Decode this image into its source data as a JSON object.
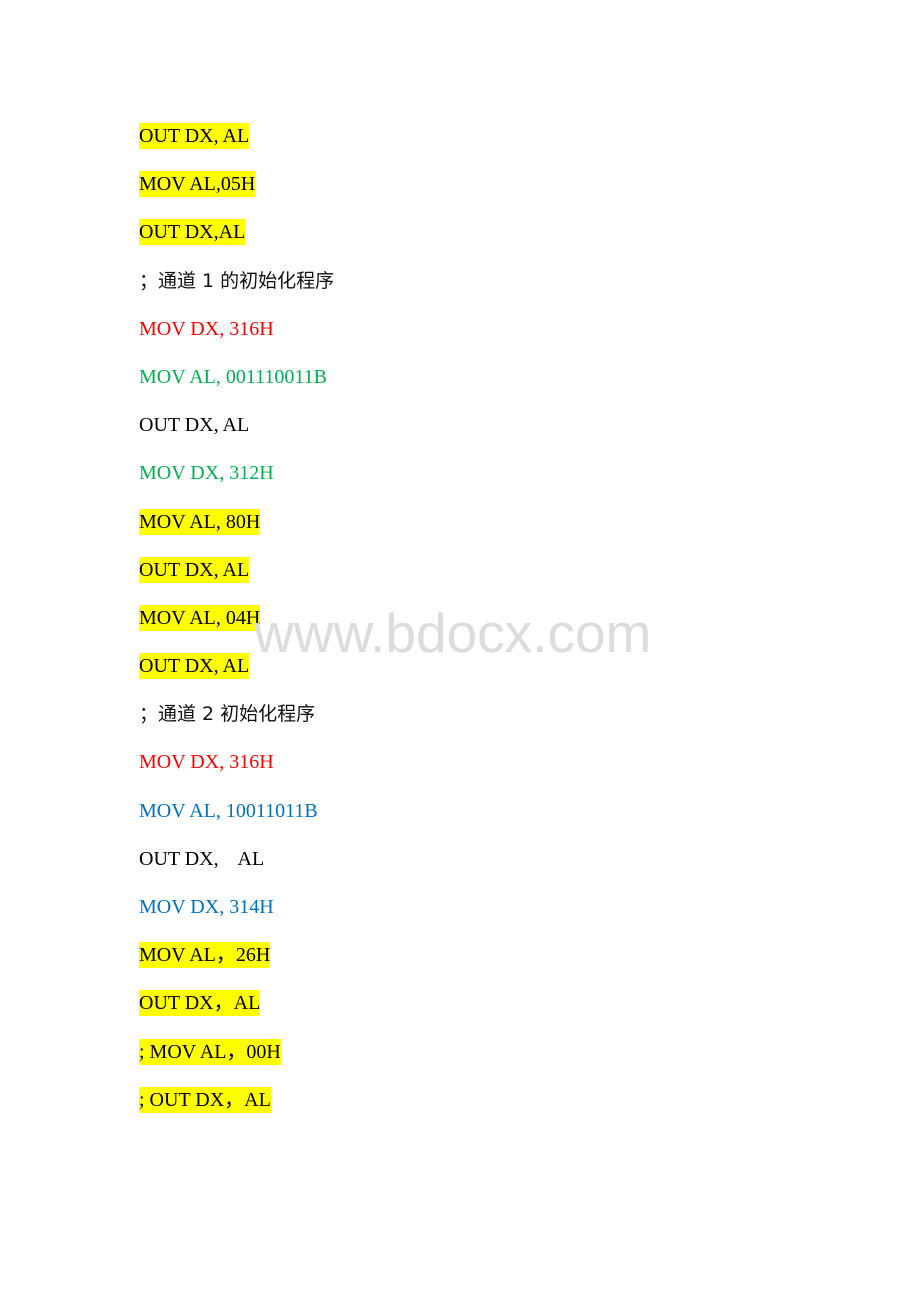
{
  "document": {
    "lines": [
      {
        "text": "OUT DX, AL",
        "color": "black",
        "highlight": true
      },
      {
        "text": "MOV AL,05H",
        "color": "black",
        "highlight": true
      },
      {
        "text": "OUT DX,AL",
        "color": "black",
        "highlight": true
      },
      {
        "text": "；通道 1 的初始化程序",
        "color": "comment",
        "highlight": false
      },
      {
        "text": "MOV DX, 316H",
        "color": "red",
        "highlight": false
      },
      {
        "text": "MOV AL, 001110011B",
        "color": "green",
        "highlight": false
      },
      {
        "text": "OUT DX, AL",
        "color": "black",
        "highlight": false
      },
      {
        "text": "MOV DX, 312H",
        "color": "green",
        "highlight": false
      },
      {
        "text": "MOV AL, 80H",
        "color": "black",
        "highlight": true
      },
      {
        "text": "OUT DX, AL",
        "color": "black",
        "highlight": true
      },
      {
        "text": "MOV AL, 04H",
        "color": "black",
        "highlight": true
      },
      {
        "text": "OUT DX, AL",
        "color": "black",
        "highlight": true
      },
      {
        "text": "；通道 2 初始化程序",
        "color": "comment",
        "highlight": false
      },
      {
        "text": "MOV DX, 316H",
        "color": "red",
        "highlight": false
      },
      {
        "text": "MOV AL, 10011011B",
        "color": "blue",
        "highlight": false
      },
      {
        "text": "OUT DX,    AL",
        "color": "black",
        "highlight": false
      },
      {
        "text": "MOV DX, 314H",
        "color": "blue",
        "highlight": false
      },
      {
        "text": "MOV AL，26H",
        "color": "black",
        "highlight": true
      },
      {
        "text": "OUT DX，AL",
        "color": "black",
        "highlight": true
      },
      {
        "text": "; MOV AL，00H",
        "color": "black",
        "highlight": true
      },
      {
        "text": "; OUT DX，AL",
        "color": "black",
        "highlight": true
      }
    ]
  },
  "colors": {
    "highlight": "#ffff00",
    "black": "#000000",
    "red": "#ff0000",
    "green": "#00b050",
    "blue": "#0070c0",
    "watermark": "#dcdcdc"
  },
  "watermark": {
    "text": "www.bdocx.com"
  }
}
